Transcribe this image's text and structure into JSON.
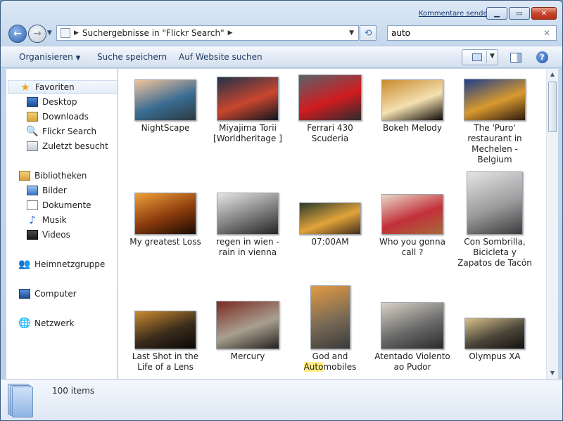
{
  "title_bar": {
    "comments_link": "Kommentare senden"
  },
  "address": {
    "path": "Suchergebnisse in \"Flickr Search\"",
    "search_value": "auto",
    "search_clear": "✕"
  },
  "toolbar": {
    "organize": "Organisieren",
    "save_search": "Suche speichern",
    "web_search": "Auf Website suchen"
  },
  "nav": {
    "favorites": "Favoriten",
    "fav_items": [
      "Desktop",
      "Downloads",
      "Flickr Search",
      "Zuletzt besucht"
    ],
    "libraries": "Bibliotheken",
    "lib_items": [
      "Bilder",
      "Dokumente",
      "Musik",
      "Videos"
    ],
    "homegroup": "Heimnetzgruppe",
    "computer": "Computer",
    "network": "Netzwerk"
  },
  "items": [
    {
      "label": "NightScape",
      "colors": [
        "#f2c39a",
        "#3a6c93",
        "#2b3a40"
      ]
    },
    {
      "label": "Miyajima Torii [Worldheritage ]",
      "colors": [
        "#21324a",
        "#c9462e",
        "#0d1620"
      ]
    },
    {
      "label": "Ferrari 430 Scuderia",
      "colors": [
        "#5a6368",
        "#d01c20",
        "#2a2b2e"
      ]
    },
    {
      "label": "Bokeh Melody",
      "colors": [
        "#c98a2e",
        "#f4e0b0",
        "#0c0a06"
      ]
    },
    {
      "label": "The 'Puro' restaurant in Mechelen - Belgium",
      "colors": [
        "#1e3e8a",
        "#d9992e",
        "#2b1a10"
      ]
    },
    {
      "label": "My greatest Loss",
      "colors": [
        "#f0a13a",
        "#8a3a0c",
        "#1a0c04"
      ]
    },
    {
      "label": "regen in wien - rain in vienna",
      "colors": [
        "#e6e6e6",
        "#7d7d7d",
        "#252525"
      ]
    },
    {
      "label": "07:00AM",
      "colors": [
        "#2a3a2c",
        "#e1a43a",
        "#402c1a"
      ]
    },
    {
      "label": "Who you gonna call ?",
      "colors": [
        "#e8d9c8",
        "#c3303a",
        "#a56a3a"
      ]
    },
    {
      "label": "Con Sombrilla, Bicicleta y Zapatos de Tacón",
      "colors": [
        "#e4e4e4",
        "#9c9c9c",
        "#3b3b3b"
      ]
    },
    {
      "label": "Last Shot in the Life of a Lens",
      "colors": [
        "#cc8a30",
        "#3a2c1c",
        "#090806"
      ]
    },
    {
      "label": "Mercury",
      "colors": [
        "#7b2a20",
        "#a99f90",
        "#23201c"
      ]
    },
    {
      "label": "God and Automobiles",
      "label_pre": "God and ",
      "label_hl": "Auto",
      "label_post": "mobiles",
      "colors": [
        "#e39a42",
        "#7a6a56",
        "#3a3a3a"
      ]
    },
    {
      "label": "Atentado Violento ao Pudor",
      "colors": [
        "#d9d3c6",
        "#6a6a6a",
        "#2a2a2a"
      ]
    },
    {
      "label": "Olympus XA",
      "colors": [
        "#d7c18a",
        "#4a4538",
        "#141210"
      ]
    }
  ],
  "details": {
    "count": "100 items"
  }
}
